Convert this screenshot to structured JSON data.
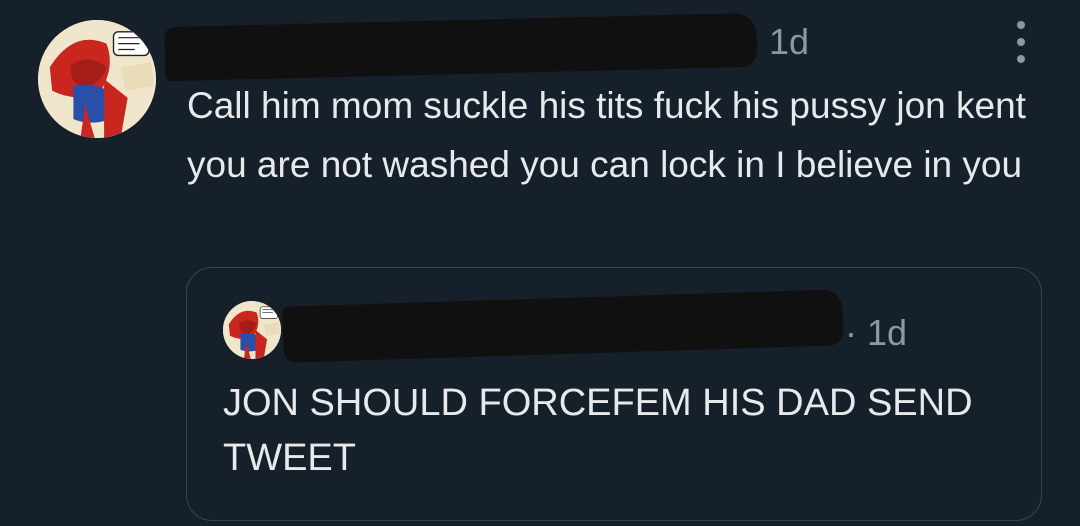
{
  "tweet": {
    "avatar_icon": "avatar-image",
    "time": "1d",
    "more_icon": "more-options-icon",
    "text": "Call him mom suckle his tits fuck his pussy jon kent you are not washed you can lock in I believe in you"
  },
  "quote": {
    "avatar_icon": "avatar-image",
    "time": "· 1d",
    "text": "JON SHOULD FORCEFEM HIS DAD SEND TWEET"
  },
  "colors": {
    "background": "#15202b",
    "text_primary": "#e7e9ea",
    "text_secondary": "#8b98a5",
    "border": "#38444d",
    "redaction": "#101010"
  }
}
